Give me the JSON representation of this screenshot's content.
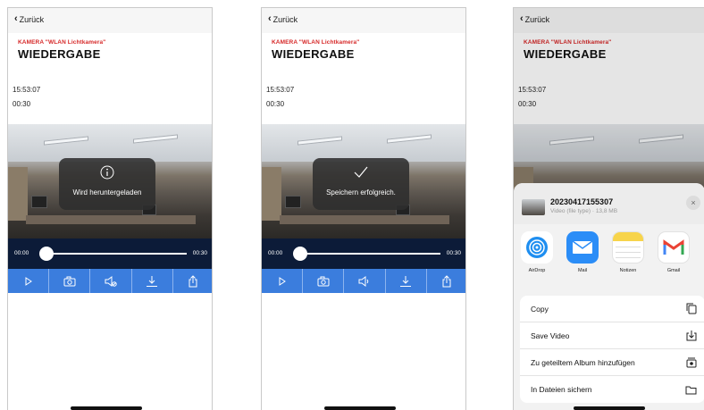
{
  "screens": [
    {
      "back_label": "Zurück",
      "subtitle": "KAMERA \"WLAN Lichtkamera\"",
      "title": "WIEDERGABE",
      "time": "15:53:07",
      "duration": "00:30",
      "toast": {
        "icon": "info-icon",
        "text": "Wird heruntergeladen"
      },
      "slider": {
        "start": "00:00",
        "end": "00:30",
        "progress": 0
      },
      "controls": [
        "play-icon",
        "camera-icon",
        "mute-icon",
        "download-icon",
        "share-icon"
      ]
    },
    {
      "back_label": "Zurück",
      "subtitle": "KAMERA \"WLAN Lichtkamera\"",
      "title": "WIEDERGABE",
      "time": "15:53:07",
      "duration": "00:30",
      "toast": {
        "icon": "checkmark-icon",
        "text": "Speichern erfolgreich."
      },
      "slider": {
        "start": "00:00",
        "end": "00:30",
        "progress": 0
      },
      "controls": [
        "play-icon",
        "camera-icon",
        "volume-icon",
        "download-icon",
        "share-icon"
      ]
    },
    {
      "back_label": "Zurück",
      "subtitle": "KAMERA \"WLAN Lichtkamera\"",
      "title": "WIEDERGABE",
      "time": "15:53:07",
      "duration": "00:30",
      "share_sheet": {
        "file_name": "20230417155307",
        "file_info": "Video (file type) · 13,8 MB",
        "close": "×",
        "apps": [
          {
            "label": "AirDrop",
            "icon": "airdrop-icon",
            "color": "#1e8ef0"
          },
          {
            "label": "Mail",
            "icon": "mail-icon",
            "color": "#2b8df7"
          },
          {
            "label": "Notizen",
            "icon": "notes-icon",
            "color": "#f7d44b"
          },
          {
            "label": "Gmail",
            "icon": "gmail-icon",
            "color": "#ffffff"
          }
        ],
        "actions": [
          {
            "label": "Copy",
            "icon": "copy-icon"
          },
          {
            "label": "Save Video",
            "icon": "save-video-icon"
          },
          {
            "label": "Zu geteiltem Album hinzufügen",
            "icon": "shared-album-icon"
          },
          {
            "label": "In Dateien sichern",
            "icon": "folder-icon"
          }
        ]
      }
    }
  ],
  "colors": {
    "accent": "#3b7ddd",
    "red": "#d62828",
    "slider_bg": "#0c1b38"
  }
}
